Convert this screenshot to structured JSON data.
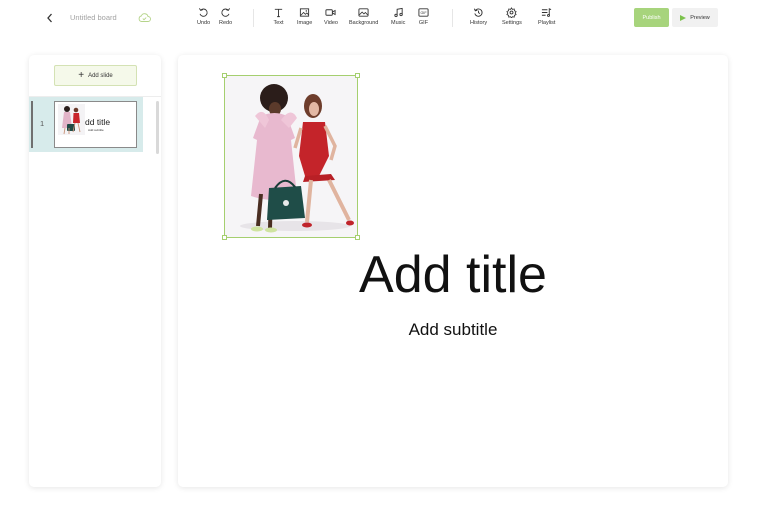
{
  "header": {
    "board_name": "Untitled board",
    "tools": {
      "undo": "Undo",
      "redo": "Redo",
      "text": "Text",
      "image": "Image",
      "video": "Video",
      "background": "Background",
      "music": "Music",
      "gif": "GIF",
      "history": "History",
      "settings": "Settings",
      "playlist": "Playlist"
    },
    "publish_label": "Publish",
    "preview_label": "Preview"
  },
  "sidebar": {
    "add_slide_label": "Add slide",
    "slides": [
      {
        "number": "1",
        "thumb_title": "dd title",
        "thumb_subtitle": "Add subtitle"
      }
    ]
  },
  "slide": {
    "title": "Add title",
    "subtitle": "Add subtitle"
  },
  "colors": {
    "accent_green": "#a7d47c",
    "selection_border": "#a5cf6f",
    "active_slide_bg": "#d7ebeb"
  },
  "icons": [
    "chevron-left-icon",
    "cloud-check-icon",
    "undo-icon",
    "redo-icon",
    "text-icon",
    "image-icon",
    "video-icon",
    "background-icon",
    "music-icon",
    "gif-icon",
    "history-icon",
    "gear-icon",
    "playlist-icon",
    "play-icon",
    "plus-icon"
  ]
}
